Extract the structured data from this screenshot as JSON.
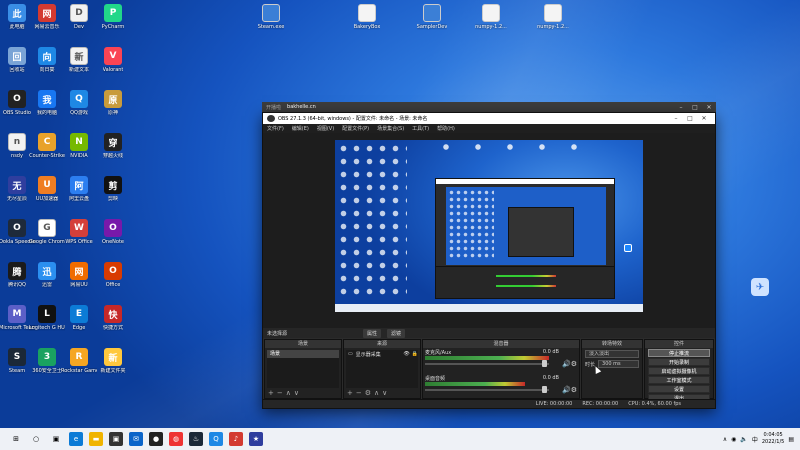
{
  "desktop": {
    "icons": [
      {
        "label": "此电脑",
        "icon": "pc-icon",
        "color": "#3a8ee6"
      },
      {
        "label": "回收站",
        "icon": "recycle-bin-icon",
        "color": "#7aa4d6"
      },
      {
        "label": "OBS Studio",
        "icon": "obs-icon",
        "color": "#222222"
      },
      {
        "label": "nsdy",
        "icon": "file-icon",
        "color": "#f2f2f2"
      },
      {
        "label": "无尽星辰",
        "icon": "game-icon",
        "color": "#2f3e9e"
      },
      {
        "label": "Ookla Speedtest",
        "icon": "speed-icon",
        "color": "#1e2a3b"
      },
      {
        "label": "腾讯QQ",
        "icon": "qq-icon",
        "color": "#1b1b1b"
      },
      {
        "label": "Microsoft Teams",
        "icon": "teams-icon",
        "color": "#5b5fc7"
      },
      {
        "label": "Steam",
        "icon": "steam-icon",
        "color": "#1b2838"
      },
      {
        "label": "网易云音乐",
        "icon": "music-icon",
        "color": "#d33a31"
      },
      {
        "label": "向日葵",
        "icon": "sun-icon",
        "color": "#1e88e5"
      },
      {
        "label": "我的电脑",
        "icon": "monitor-icon",
        "color": "#1877f2"
      },
      {
        "label": "Counter-Strike",
        "icon": "cs-icon",
        "color": "#e8a22a"
      },
      {
        "label": "UU加速器",
        "icon": "uu-icon",
        "color": "#ef7d22"
      },
      {
        "label": "Google Chrome",
        "icon": "chrome-icon",
        "color": "#ffffff"
      },
      {
        "label": "迅雷",
        "icon": "thunder-icon",
        "color": "#2b8ff0"
      },
      {
        "label": "Logitech G HUB",
        "icon": "logitech-icon",
        "color": "#111111"
      },
      {
        "label": "360安全卫士",
        "icon": "shield-icon",
        "color": "#1aa260"
      },
      {
        "label": "Dev",
        "icon": "file-icon",
        "color": "#f2f2f2"
      },
      {
        "label": "新建文本",
        "icon": "file-icon",
        "color": "#f2f2f2"
      },
      {
        "label": "QQ游戏",
        "icon": "qqgame-icon",
        "color": "#1e88e5"
      },
      {
        "label": "NVIDIA",
        "icon": "nvidia-icon",
        "color": "#76b900"
      },
      {
        "label": "阿里云盘",
        "icon": "cloud-icon",
        "color": "#2c7ef0"
      },
      {
        "label": "WPS Office",
        "icon": "wps-icon",
        "color": "#d43f3a"
      },
      {
        "label": "网易UU",
        "icon": "uu-icon",
        "color": "#ef6c00"
      },
      {
        "label": "Edge",
        "icon": "edge-icon",
        "color": "#0c7bd6"
      },
      {
        "label": "Rockstar Games",
        "icon": "rockstar-icon",
        "color": "#f5a623"
      },
      {
        "label": "PyCharm",
        "icon": "pycharm-icon",
        "color": "#21d789"
      },
      {
        "label": "Valorant",
        "icon": "valorant-icon",
        "color": "#fa4454"
      },
      {
        "label": "原神",
        "icon": "genshin-icon",
        "color": "#c89b3c"
      },
      {
        "label": "穿越火线",
        "icon": "cf-icon",
        "color": "#222222"
      },
      {
        "label": "剪映",
        "icon": "jianying-icon",
        "color": "#111111"
      },
      {
        "label": "OneNote",
        "icon": "onenote-icon",
        "color": "#7719aa"
      },
      {
        "label": "Office",
        "icon": "office-icon",
        "color": "#d83b01"
      },
      {
        "label": "快捷方式",
        "icon": "shortcut-icon",
        "color": "#c62828"
      },
      {
        "label": "新建文件夹",
        "icon": "folder-icon",
        "color": "#ffc83d"
      }
    ],
    "top_icons": [
      {
        "label": "Steam.exe",
        "icon": "window-icon"
      },
      {
        "label": "BakeryBox",
        "icon": "file-icon"
      },
      {
        "label": "SamplerDev",
        "icon": "arrow-icon"
      },
      {
        "label": "numpy-1.2...",
        "icon": "file-icon"
      },
      {
        "label": "numpy-1.2...",
        "icon": "file-icon"
      }
    ]
  },
  "obs": {
    "title": "OBS 27.1.3 (64-bit, windows) - 配置文件: 未命名 - 场景: 未命名",
    "menu": [
      "文件(F)",
      "编辑(E)",
      "视图(V)",
      "配置文件(P)",
      "场景集合(S)",
      "工具(T)",
      "帮助(H)"
    ],
    "tabs": [
      "属性",
      "滤镜"
    ],
    "no_source": "未选择源",
    "docks": {
      "scenes": {
        "title": "场景",
        "items": [
          "场景"
        ]
      },
      "sources": {
        "title": "来源",
        "items": [
          "显示器采集"
        ]
      },
      "mixer": {
        "title": "混音器",
        "tracks": [
          {
            "name": "麦克风/Aux",
            "db": "0.0 dB"
          },
          {
            "name": "桌面音频",
            "db": "0.0 dB"
          }
        ]
      },
      "transitions": {
        "title": "转场特效",
        "type": "淡入淡出",
        "duration_label": "时长",
        "duration": "300 ms"
      },
      "controls": {
        "title": "控件",
        "buttons": [
          "停止推流",
          "开始录制",
          "启动虚拟摄像机",
          "工作室模式",
          "设置",
          "退出"
        ]
      }
    },
    "status": {
      "live": "LIVE: 00:00:00",
      "rec": "REC: 00:00:00",
      "cpu": "CPU: 0.4%, 60.00 fps"
    }
  },
  "behind_window": {
    "title": "bakhelle.cn"
  },
  "taskbar": {
    "items": [
      "start-icon",
      "search-icon",
      "taskview-icon",
      "edge-icon",
      "explorer-icon",
      "store-icon",
      "mail-icon",
      "obs-icon",
      "chrome-icon",
      "steam-icon",
      "qq-icon",
      "music-icon",
      "game-icon"
    ],
    "time": "0:04:05",
    "date": "2022/1/5",
    "lang": "中"
  }
}
